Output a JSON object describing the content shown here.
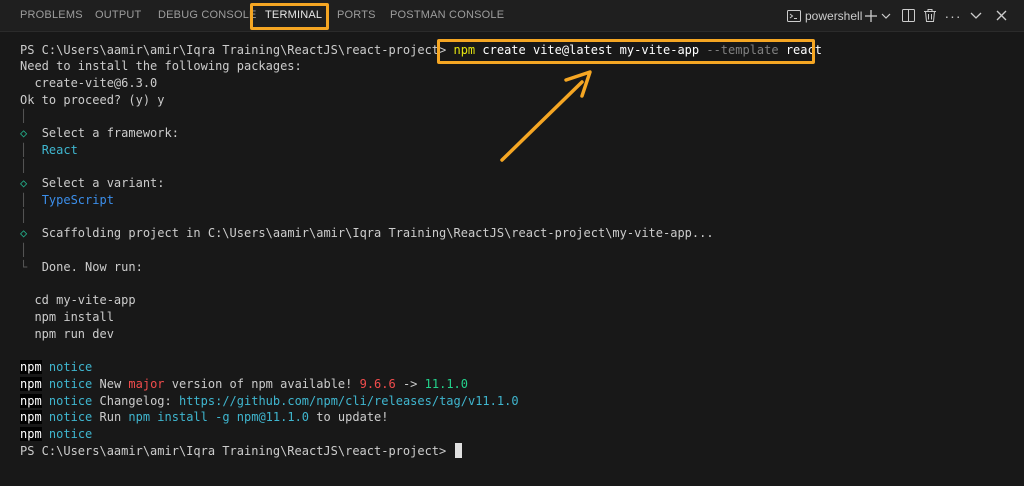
{
  "panel": {
    "tabs": [
      {
        "label": "PROBLEMS"
      },
      {
        "label": "OUTPUT"
      },
      {
        "label": "DEBUG CONSOLE"
      },
      {
        "label": "TERMINAL"
      },
      {
        "label": "PORTS"
      },
      {
        "label": "POSTMAN CONSOLE"
      }
    ],
    "active_tab": "TERMINAL",
    "shell_label": "powershell",
    "icons": [
      "terminal-icon",
      "plus-icon",
      "chevron-down-icon",
      "split-icon",
      "trash-icon",
      "more-icon",
      "collapse-icon",
      "close-icon"
    ]
  },
  "colors": {
    "highlight": "#f5a623",
    "background": "#181818",
    "cyan": "#3fb6cf",
    "red": "#f14c4c",
    "green": "#23d18b"
  },
  "terminal": {
    "prompt": "PS C:\\Users\\aamir\\amir\\Iqra Training\\ReactJS\\react-project> ",
    "command": {
      "npm": "npm",
      "args1": " create vite@latest my-vite-app ",
      "flag": "--template",
      "args2": " react"
    },
    "install_notice": "Need to install the following packages:",
    "package": "  create-vite@6.3.0",
    "proceed": "Ok to proceed? (y) y",
    "framework_q": "Select a framework:",
    "framework_a": "React",
    "variant_q": "Select a variant:",
    "variant_a": "TypeScript",
    "scaffold": "Scaffolding project in C:\\Users\\aamir\\amir\\Iqra Training\\ReactJS\\react-project\\my-vite-app...",
    "done": "Done. Now run:",
    "next_steps": [
      "  cd my-vite-app",
      "  npm install",
      "  npm run dev"
    ],
    "npm_tag": "npm",
    "notice_word": "notice",
    "notice1_text": " New ",
    "notice1_major": "major",
    "notice1_mid": " version of npm available! ",
    "notice1_old": "9.6.6",
    "notice1_arrow": " -> ",
    "notice1_new": "11.1.0",
    "notice2_text": " Changelog: ",
    "notice2_url": "https://github.com/npm/cli/releases/tag/v11.1.0",
    "notice3_text": " Run ",
    "notice3_cmd": "npm install -g npm@11.1.0",
    "notice3_end": " to update!",
    "final_prompt": "PS C:\\Users\\aamir\\amir\\Iqra Training\\ReactJS\\react-project> "
  }
}
